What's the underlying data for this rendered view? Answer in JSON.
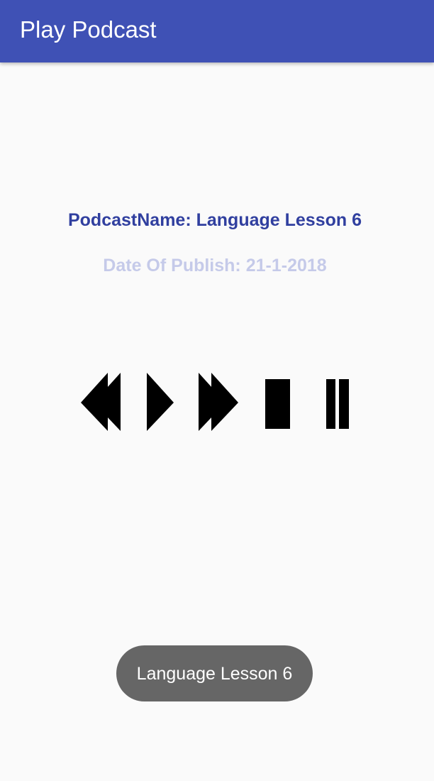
{
  "app_bar": {
    "title": "Play Podcast",
    "color": "#3f51b5"
  },
  "podcast": {
    "name_text": "PodcastName: Language Lesson 6",
    "date_text": "Date Of Publish: 21-1-2018",
    "name_color": "#303f9f",
    "date_color": "#c5cae9"
  },
  "controls": {
    "items": [
      {
        "id": "rewind",
        "icon": "rewind-icon"
      },
      {
        "id": "play",
        "icon": "play-icon"
      },
      {
        "id": "fast-forward",
        "icon": "fast-forward-icon"
      },
      {
        "id": "stop",
        "icon": "stop-icon"
      },
      {
        "id": "pause",
        "icon": "pause-icon"
      }
    ]
  },
  "toast": {
    "text": "Language Lesson 6",
    "background": "#666666"
  }
}
